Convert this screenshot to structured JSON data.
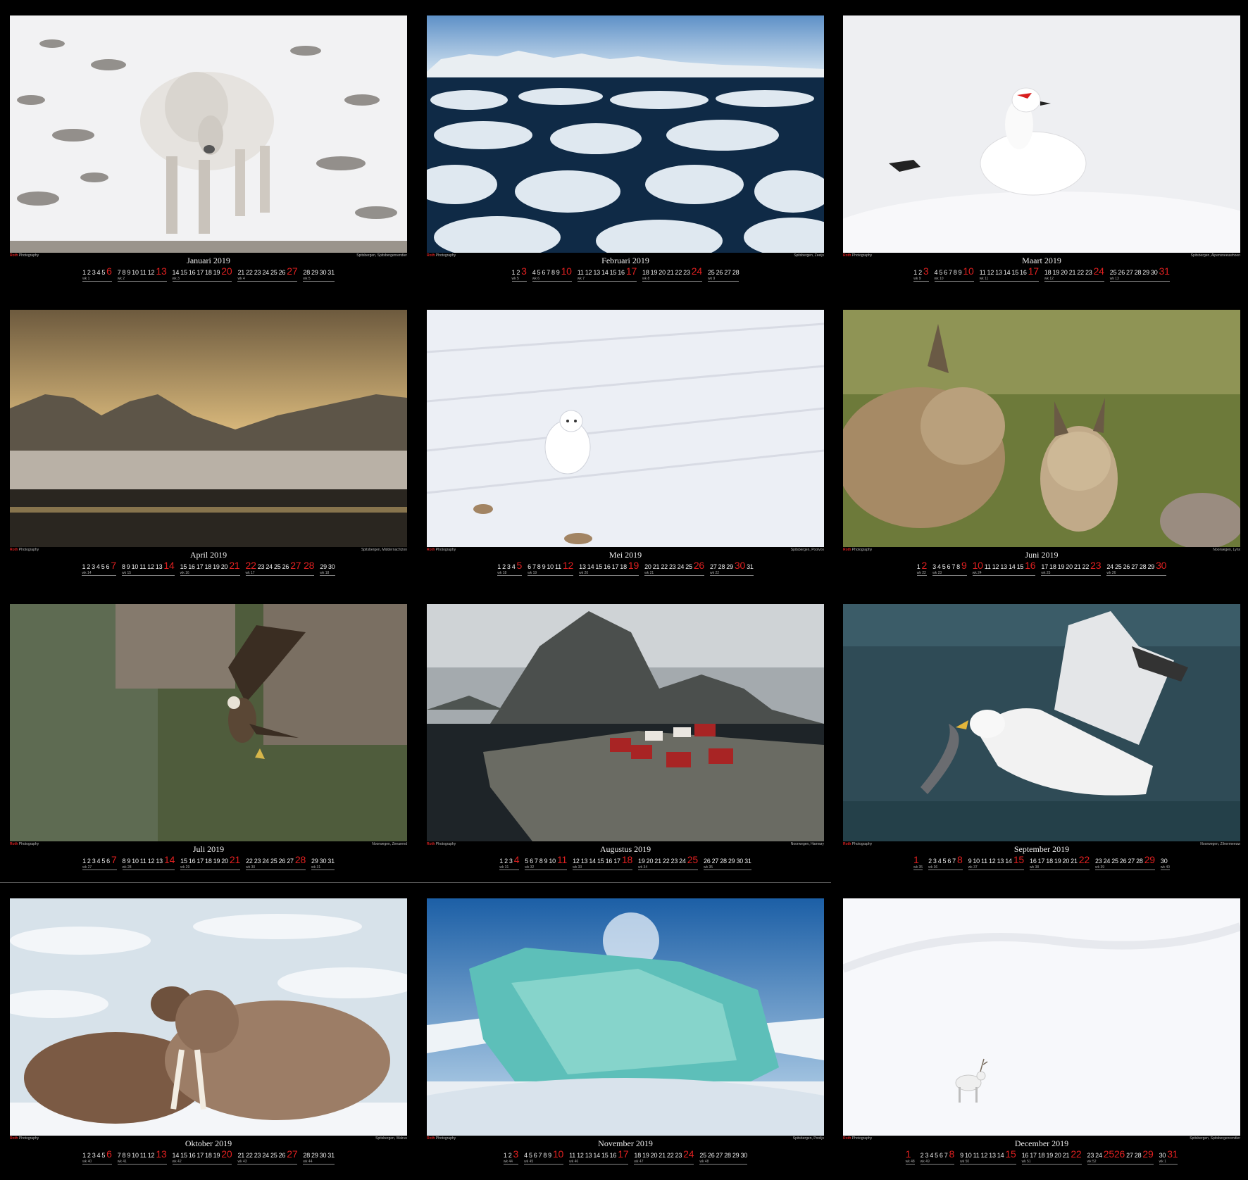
{
  "brand": {
    "name_red": "Roth",
    "name_rest": " Photography"
  },
  "pages": [
    {
      "month": "Januari 2019",
      "caption": "Spitsbergen, Spitsbergenrendier",
      "scene": "reindeer",
      "weeks": [
        {
          "d": [
            "1",
            "2",
            "3",
            "4",
            "5"
          ],
          "s": "6",
          "wk": "wk 1"
        },
        {
          "d": [
            "7",
            "8",
            "9",
            "10",
            "11",
            "12"
          ],
          "s": "13",
          "wk": "wk 2"
        },
        {
          "d": [
            "14",
            "15",
            "16",
            "17",
            "18",
            "19"
          ],
          "s": "20",
          "wk": "wk 3"
        },
        {
          "d": [
            "21",
            "22",
            "23",
            "24",
            "25",
            "26"
          ],
          "s": "27",
          "wk": "wk 4"
        },
        {
          "d": [
            "28",
            "29",
            "30",
            "31"
          ],
          "s": "",
          "wk": "wk 5"
        }
      ]
    },
    {
      "month": "Februari 2019",
      "caption": "Spitsbergen, Zeeijs",
      "scene": "seaice",
      "weeks": [
        {
          "d": [
            "1",
            "2"
          ],
          "s": "3",
          "wk": "wk 5"
        },
        {
          "d": [
            "4",
            "5",
            "6",
            "7",
            "8",
            "9"
          ],
          "s": "10",
          "wk": "wk 6"
        },
        {
          "d": [
            "11",
            "12",
            "13",
            "14",
            "15",
            "16"
          ],
          "s": "17",
          "wk": "wk 7"
        },
        {
          "d": [
            "18",
            "19",
            "20",
            "21",
            "22",
            "23"
          ],
          "s": "24",
          "wk": "wk 8"
        },
        {
          "d": [
            "25",
            "26",
            "27",
            "28"
          ],
          "s": "",
          "wk": "wk 9"
        }
      ]
    },
    {
      "month": "Maart 2019",
      "caption": "Spitsbergen, Alpensneeuwhoen",
      "scene": "ptarmigan",
      "weeks": [
        {
          "d": [
            "1",
            "2"
          ],
          "s": "3",
          "wk": "wk 9"
        },
        {
          "d": [
            "4",
            "5",
            "6",
            "7",
            "8",
            "9"
          ],
          "s": "10",
          "wk": "wk 10"
        },
        {
          "d": [
            "11",
            "12",
            "13",
            "14",
            "15",
            "16"
          ],
          "s": "17",
          "wk": "wk 11"
        },
        {
          "d": [
            "18",
            "19",
            "20",
            "21",
            "22",
            "23"
          ],
          "s": "24",
          "wk": "wk 12"
        },
        {
          "d": [
            "25",
            "26",
            "27",
            "28",
            "29",
            "30"
          ],
          "s": "31",
          "wk": "wk 13"
        }
      ]
    },
    {
      "month": "April 2019",
      "caption": "Spitsbergen, Middernachtzon",
      "scene": "sunset",
      "weeks": [
        {
          "d": [
            "1",
            "2",
            "3",
            "4",
            "5",
            "6"
          ],
          "s": "7",
          "wk": "wk 14"
        },
        {
          "d": [
            "8",
            "9",
            "10",
            "11",
            "12",
            "13"
          ],
          "s": "14",
          "wk": "wk 15"
        },
        {
          "d": [
            "15",
            "16",
            "17",
            "18",
            "19",
            "20"
          ],
          "s": "21",
          "wk": "wk 16"
        },
        {
          "d": [],
          "r": [
            "22"
          ],
          "d2": [
            "23",
            "24",
            "25",
            "26"
          ],
          "s": "27 28",
          "wk": "wk 17"
        },
        {
          "d": [
            "29",
            "30"
          ],
          "s": "",
          "wk": "wk 18"
        }
      ]
    },
    {
      "month": "Mei 2019",
      "caption": "Spitsbergen, Poolvos",
      "scene": "fox",
      "weeks": [
        {
          "d": [
            "1",
            "2",
            "3",
            "4"
          ],
          "s": "5",
          "wk": "wk 18"
        },
        {
          "d": [
            "6",
            "7",
            "8",
            "9",
            "10",
            "11"
          ],
          "s": "12",
          "wk": "wk 19"
        },
        {
          "d": [
            "13",
            "14",
            "15",
            "16",
            "17",
            "18"
          ],
          "s": "19",
          "wk": "wk 20"
        },
        {
          "d": [
            "20",
            "21",
            "22",
            "23",
            "24",
            "25"
          ],
          "s": "26",
          "wk": "wk 21"
        },
        {
          "d": [
            "27",
            "28",
            "29"
          ],
          "r": [
            "30"
          ],
          "d2": [
            "31"
          ],
          "s": "",
          "wk": "wk 22"
        }
      ]
    },
    {
      "month": "Juni 2019",
      "caption": "Noorwegen, Lynx",
      "scene": "lynx",
      "weeks": [
        {
          "d": [
            "1"
          ],
          "s": "2",
          "wk": "wk 22"
        },
        {
          "d": [
            "3",
            "4",
            "5",
            "6",
            "7",
            "8"
          ],
          "s": "9",
          "wk": "wk 23"
        },
        {
          "d": [],
          "r": [
            "10"
          ],
          "d2": [
            "11",
            "12",
            "13",
            "14",
            "15"
          ],
          "s": "16",
          "wk": "wk 24"
        },
        {
          "d": [
            "17",
            "18",
            "19",
            "20",
            "21",
            "22"
          ],
          "s": "23",
          "wk": "wk 25"
        },
        {
          "d": [
            "24",
            "25",
            "26",
            "27",
            "28",
            "29"
          ],
          "s": "30",
          "wk": "wk 26"
        }
      ]
    },
    {
      "month": "Juli 2019",
      "caption": "Noorwegen, Zeearend",
      "scene": "eagle",
      "weeks": [
        {
          "d": [
            "1",
            "2",
            "3",
            "4",
            "5",
            "6"
          ],
          "s": "7",
          "wk": "wk 27"
        },
        {
          "d": [
            "8",
            "9",
            "10",
            "11",
            "12",
            "13"
          ],
          "s": "14",
          "wk": "wk 28"
        },
        {
          "d": [
            "15",
            "16",
            "17",
            "18",
            "19",
            "20"
          ],
          "s": "21",
          "wk": "wk 29"
        },
        {
          "d": [
            "22",
            "23",
            "24",
            "25",
            "26",
            "27"
          ],
          "s": "28",
          "wk": "wk 30"
        },
        {
          "d": [
            "29",
            "30",
            "31"
          ],
          "s": "",
          "wk": "wk 31"
        }
      ]
    },
    {
      "month": "Augustus 2019",
      "caption": "Noorwegen, Hamnøy",
      "scene": "village",
      "weeks": [
        {
          "d": [
            "1",
            "2",
            "3"
          ],
          "s": "4",
          "wk": "wk 31"
        },
        {
          "d": [
            "5",
            "6",
            "7",
            "8",
            "9",
            "10"
          ],
          "s": "11",
          "wk": "wk 32"
        },
        {
          "d": [
            "12",
            "13",
            "14",
            "15",
            "16",
            "17"
          ],
          "s": "18",
          "wk": "wk 33"
        },
        {
          "d": [
            "19",
            "20",
            "21",
            "22",
            "23",
            "24"
          ],
          "s": "25",
          "wk": "wk 34"
        },
        {
          "d": [
            "26",
            "27",
            "28",
            "29",
            "30",
            "31"
          ],
          "s": "",
          "wk": "wk 35"
        }
      ]
    },
    {
      "month": "September 2019",
      "caption": "Noorwegen, Zilvermeeuw",
      "scene": "gull",
      "weeks": [
        {
          "d": [],
          "s": "1",
          "wk": "wk 35"
        },
        {
          "d": [
            "2",
            "3",
            "4",
            "5",
            "6",
            "7"
          ],
          "s": "8",
          "wk": "wk 36"
        },
        {
          "d": [
            "9",
            "10",
            "11",
            "12",
            "13",
            "14"
          ],
          "s": "15",
          "wk": "wk 37"
        },
        {
          "d": [
            "16",
            "17",
            "18",
            "19",
            "20",
            "21"
          ],
          "s": "22",
          "wk": "wk 38"
        },
        {
          "d": [
            "23",
            "24",
            "25",
            "26",
            "27",
            "28"
          ],
          "s": "29",
          "wk": "wk 39"
        },
        {
          "d": [
            "30"
          ],
          "s": "",
          "wk": "wk 40"
        }
      ]
    },
    {
      "month": "Oktober 2019",
      "caption": "Spitsbergen, Walrus",
      "scene": "walrus",
      "weeks": [
        {
          "d": [
            "1",
            "2",
            "3",
            "4",
            "5"
          ],
          "s": "6",
          "wk": "wk 40"
        },
        {
          "d": [
            "7",
            "8",
            "9",
            "10",
            "11",
            "12"
          ],
          "s": "13",
          "wk": "wk 41"
        },
        {
          "d": [
            "14",
            "15",
            "16",
            "17",
            "18",
            "19"
          ],
          "s": "20",
          "wk": "wk 42"
        },
        {
          "d": [
            "21",
            "22",
            "23",
            "24",
            "25",
            "26"
          ],
          "s": "27",
          "wk": "wk 43"
        },
        {
          "d": [
            "28",
            "29",
            "30",
            "31"
          ],
          "s": "",
          "wk": "wk 44"
        }
      ]
    },
    {
      "month": "November 2019",
      "caption": "Spitsbergen, Poolijs",
      "scene": "iceberg",
      "weeks": [
        {
          "d": [
            "1",
            "2"
          ],
          "s": "3",
          "wk": "wk 44"
        },
        {
          "d": [
            "4",
            "5",
            "6",
            "7",
            "8",
            "9"
          ],
          "s": "10",
          "wk": "wk 45"
        },
        {
          "d": [
            "11",
            "12",
            "13",
            "14",
            "15",
            "16"
          ],
          "s": "17",
          "wk": "wk 46"
        },
        {
          "d": [
            "18",
            "19",
            "20",
            "21",
            "22",
            "23"
          ],
          "s": "24",
          "wk": "wk 47"
        },
        {
          "d": [
            "25",
            "26",
            "27",
            "28",
            "29",
            "30"
          ],
          "s": "",
          "wk": "wk 48"
        }
      ]
    },
    {
      "month": "December 2019",
      "caption": "Spitsbergen, Spitsbergenrendier",
      "scene": "whitereindeer",
      "weeks": [
        {
          "d": [],
          "s": "1",
          "wk": "wk 48"
        },
        {
          "d": [
            "2",
            "3",
            "4",
            "5",
            "6",
            "7"
          ],
          "s": "8",
          "wk": "wk 49"
        },
        {
          "d": [
            "9",
            "10",
            "11",
            "12",
            "13",
            "14"
          ],
          "s": "15",
          "wk": "wk 50"
        },
        {
          "d": [
            "16",
            "17",
            "18",
            "19",
            "20",
            "21"
          ],
          "s": "22",
          "wk": "wk 51"
        },
        {
          "d": [
            "23",
            "24"
          ],
          "s": "2526",
          "d3": [
            "27",
            "28"
          ],
          "s2": "29",
          "wk": "wk 52"
        },
        {
          "d": [
            "30"
          ],
          "s": "31",
          "wk": "wk 1"
        }
      ]
    }
  ]
}
